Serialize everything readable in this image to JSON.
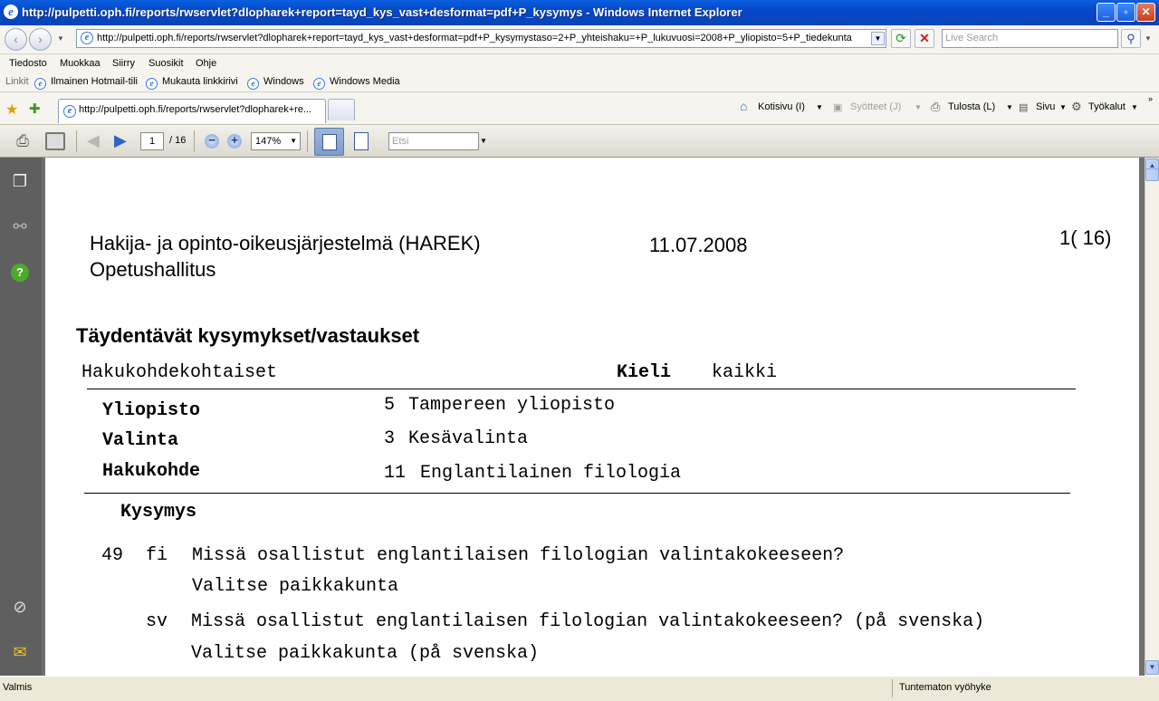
{
  "window": {
    "title": "http://pulpetti.oph.fi/reports/rwservlet?dlopharek+report=tayd_kys_vast+desformat=pdf+P_kysymys - Windows Internet Explorer"
  },
  "address": {
    "url": "http://pulpetti.oph.fi/reports/rwservlet?dlopharek+report=tayd_kys_vast+desformat=pdf+P_kysymystaso=2+P_yhteishaku=+P_lukuvuosi=2008+P_yliopisto=5+P_tiedekunta",
    "search_placeholder": "Live Search"
  },
  "menu": [
    "Tiedosto",
    "Muokkaa",
    "Siirry",
    "Suosikit",
    "Ohje"
  ],
  "links": {
    "label": "Linkit",
    "items": [
      "Ilmainen Hotmail-tili",
      "Mukauta linkkirivi",
      "Windows",
      "Windows Media"
    ]
  },
  "tabs": {
    "active": "http://pulpetti.oph.fi/reports/rwservlet?dlopharek+re...",
    "tools": {
      "home": "Kotisivu (I)",
      "feeds": "Syötteet (J)",
      "print": "Tulosta (L)",
      "page": "Sivu",
      "tools": "Työkalut"
    }
  },
  "pdf_toolbar": {
    "page": "1",
    "page_total": "/ 16",
    "zoom": "147%",
    "find_placeholder": "Etsi"
  },
  "document": {
    "system": "Hakija- ja opinto-oikeusjärjestelmä (HAREK)",
    "org": "Opetushallitus",
    "date": "11.07.2008",
    "page_label": "1( 16)",
    "heading": "Täydentävät kysymykset/vastaukset",
    "type": "Hakukohdekohtaiset",
    "lang_label": "Kieli",
    "lang_value": "kaikki",
    "fields": [
      {
        "label": "Yliopisto",
        "code": "5",
        "value": "Tampereen yliopisto"
      },
      {
        "label": "Valinta",
        "code": "3",
        "value": "Kesävalinta"
      },
      {
        "label": "Hakukohde",
        "code": "11",
        "value": "Englantilainen filologia"
      }
    ],
    "question_header": "Kysymys",
    "question_no": "49",
    "q_fi_lang": "fi",
    "q_fi_line1": "Missä osallistut englantilaisen filologian valintakokeeseen?",
    "q_fi_line2": "Valitse paikkakunta",
    "q_sv_lang": "sv",
    "q_sv_line1": "Missä osallistut englantilaisen filologian valintakokeeseen? (på svenska)",
    "q_sv_line2": "Valitse paikkakunta (på svenska)"
  },
  "status": {
    "left": "Valmis",
    "zone": "Tuntematon vyöhyke"
  }
}
